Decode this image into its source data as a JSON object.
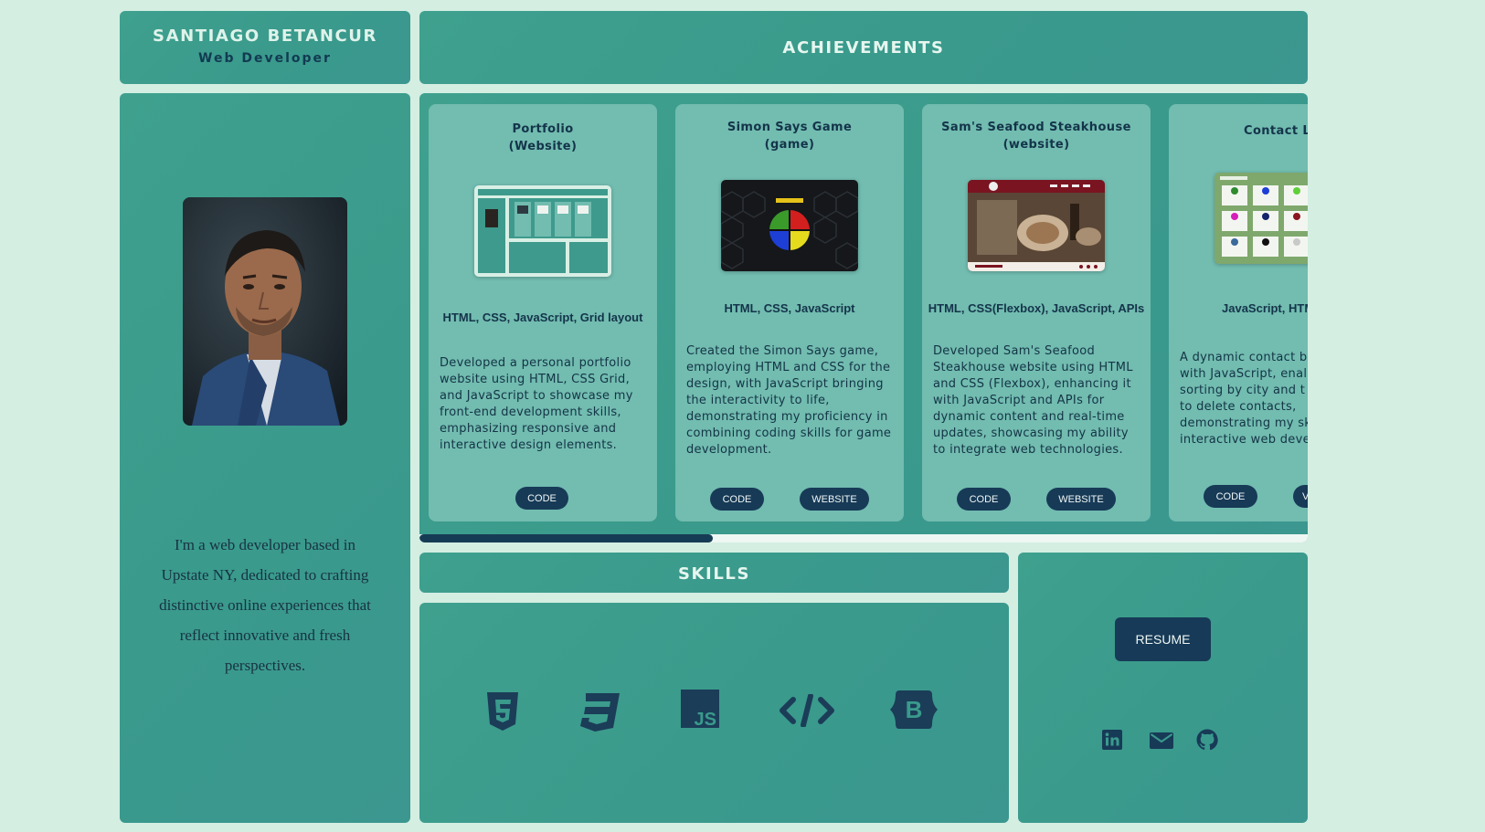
{
  "profile": {
    "name": "SANTIAGO BETANCUR",
    "role": "Web Developer",
    "bio": "I'm a web developer based in Upstate NY, dedicated to crafting distinctive online experiences that reflect innovative and fresh perspectives."
  },
  "achievements": {
    "title": "ACHIEVEMENTS",
    "cards": [
      {
        "title_line1": "Portfolio",
        "title_line2": "(Website)",
        "tech": "HTML, CSS, JavaScript, Grid layout",
        "description": "Developed a personal portfolio website using HTML, CSS Grid, and JavaScript to showcase my front-end development skills, emphasizing responsive and interactive design elements.",
        "code_label": "CODE"
      },
      {
        "title_line1": "Simon Says Game",
        "title_line2": "(game)",
        "tech": "HTML, CSS, JavaScript",
        "description": "Created the Simon Says game, employing HTML and CSS for the design, with JavaScript bringing the interactivity to life, demonstrating my proficiency in combining coding skills for game development.",
        "code_label": "CODE",
        "website_label": "WEBSITE"
      },
      {
        "title_line1": "Sam's Seafood Steakhouse",
        "title_line2": "(website)",
        "tech": "HTML, CSS(Flexbox), JavaScript, APIs",
        "description": "Developed Sam's Seafood Steakhouse website using HTML and CSS (Flexbox), enhancing it with JavaScript and APIs for dynamic content and real-time updates, showcasing my ability to integrate web technologies.",
        "code_label": "CODE",
        "website_label": "WEBSITE"
      },
      {
        "title_line1": "Contact Li",
        "tech": "JavaScript, HTM",
        "description": "A dynamic contact b with JavaScript, enal sorting by city and t to delete contacts, demonstrating my sk interactive web deve",
        "code_label": "CODE",
        "website_label": "V"
      }
    ],
    "scroll_progress": 0.33
  },
  "skills": {
    "title": "SKILLS",
    "icons": [
      "html5-icon",
      "css3-icon",
      "javascript-icon",
      "code-icon",
      "bootstrap-icon"
    ],
    "js_badge": "JS",
    "bootstrap_badge": "B"
  },
  "links": {
    "resume_label": "RESUME",
    "icons": [
      "linkedin-icon",
      "email-icon",
      "github-icon"
    ]
  },
  "colors": {
    "background": "#d4eee2",
    "panel": "#3a9a8c",
    "card": "#72bcb0",
    "accent_dark": "#163a57"
  }
}
